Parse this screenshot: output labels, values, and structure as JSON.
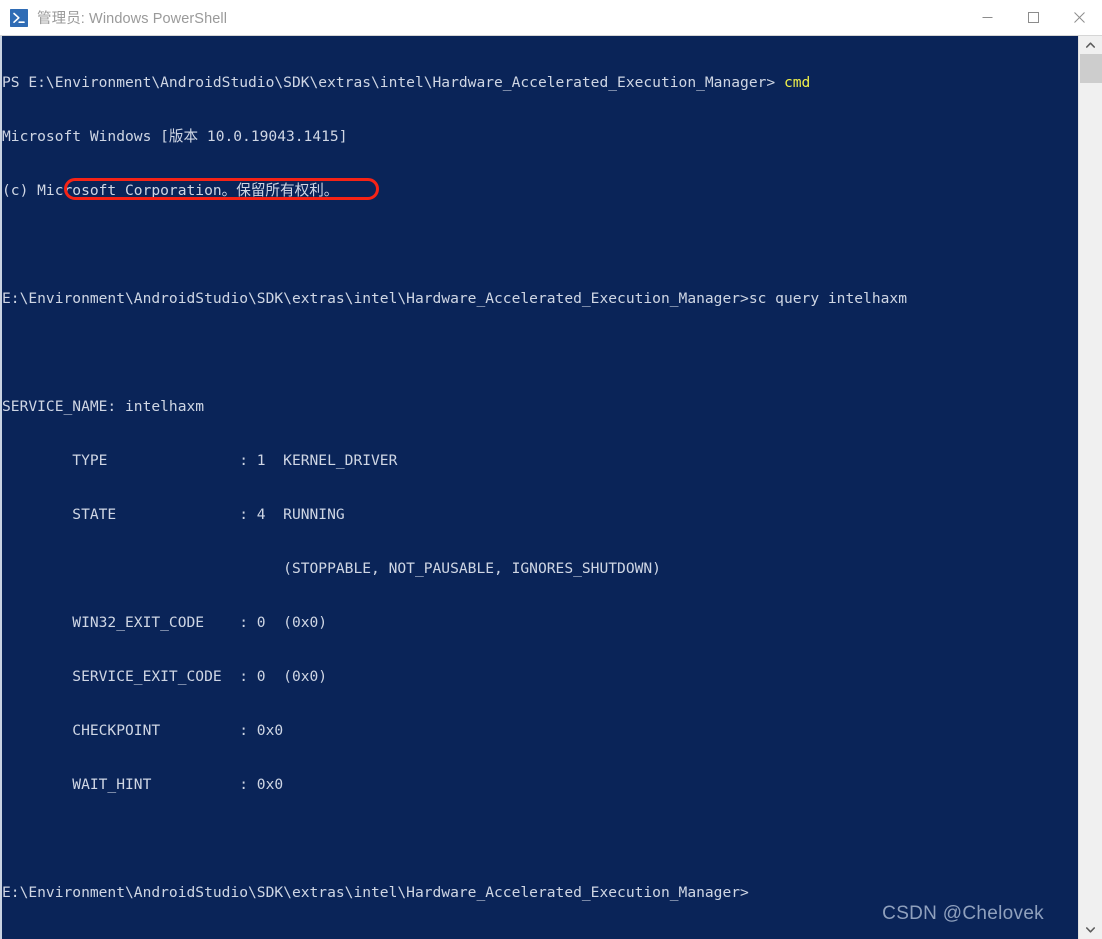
{
  "window": {
    "title": "管理员: Windows PowerShell",
    "icon": "powershell-icon",
    "controls": {
      "minimize": "minimize-icon",
      "maximize": "maximize-icon",
      "close": "close-icon"
    }
  },
  "colors": {
    "console_background": "#0a2458",
    "console_text": "#cfd6e4",
    "highlight_yellow": "#f0f04a",
    "annotation_red": "#f62316",
    "titlebar_background": "#ffffff",
    "title_text": "#9a9a9a",
    "scrollbar_track": "#f0f0f0",
    "scrollbar_thumb": "#cdcdcd",
    "watermark_text": "#8fa0bd"
  },
  "terminal": {
    "lines": [
      {
        "text": "PS E:\\Environment\\AndroidStudio\\SDK\\extras\\intel\\Hardware_Accelerated_Execution_Manager> ",
        "highlight": "cmd"
      },
      {
        "text": "Microsoft Windows [版本 10.0.19043.1415]"
      },
      {
        "text": "(c) Microsoft Corporation。保留所有权利。"
      },
      {
        "text": ""
      },
      {
        "text": "E:\\Environment\\AndroidStudio\\SDK\\extras\\intel\\Hardware_Accelerated_Execution_Manager>sc query intelhaxm"
      },
      {
        "text": ""
      },
      {
        "text": "SERVICE_NAME: intelhaxm"
      },
      {
        "text": "        TYPE               : 1  KERNEL_DRIVER"
      },
      {
        "text": "        STATE              : 4  RUNNING"
      },
      {
        "text": "                                (STOPPABLE, NOT_PAUSABLE, IGNORES_SHUTDOWN)"
      },
      {
        "text": "        WIN32_EXIT_CODE    : 0  (0x0)"
      },
      {
        "text": "        SERVICE_EXIT_CODE  : 0  (0x0)"
      },
      {
        "text": "        CHECKPOINT         : 0x0"
      },
      {
        "text": "        WAIT_HINT          : 0x0"
      },
      {
        "text": ""
      },
      {
        "text": "E:\\Environment\\AndroidStudio\\SDK\\extras\\intel\\Hardware_Accelerated_Execution_Manager>"
      }
    ],
    "command_entered": "cmd",
    "command_query": "sc query intelhaxm",
    "service_name": "intelhaxm",
    "service_state": "4  RUNNING"
  },
  "annotation": {
    "name": "state-running-highlight",
    "target_text": "STATE              : 4  RUNNING"
  },
  "watermark": {
    "text": "CSDN @Chelovek"
  },
  "scrollbar": {
    "up_arrow": "chevron-up-icon",
    "down_arrow": "chevron-down-icon"
  }
}
